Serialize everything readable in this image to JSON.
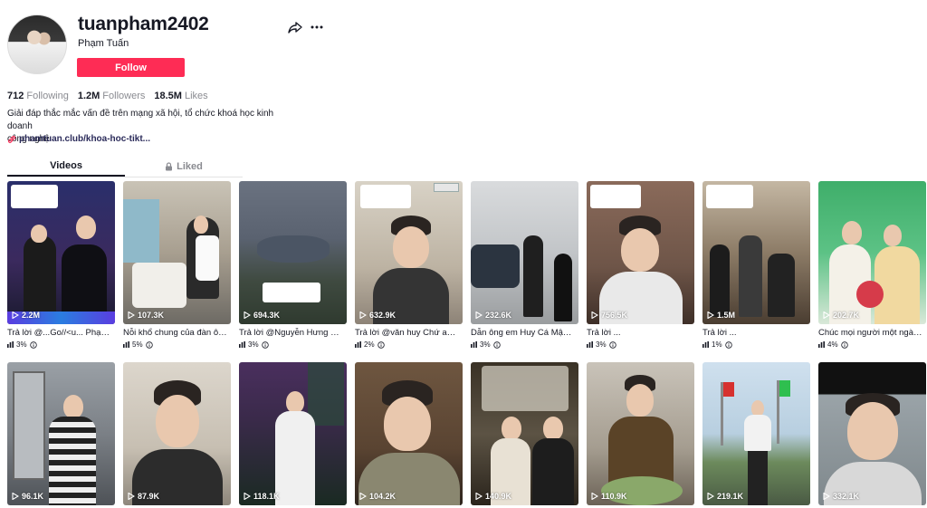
{
  "profile": {
    "username": "tuanpham2402",
    "nickname": "Phạm Tuấn",
    "follow_label": "Follow",
    "following_count": "712",
    "following_label": "Following",
    "followers_count": "1.2M",
    "followers_label": "Followers",
    "likes_count": "18.5M",
    "likes_label": "Likes",
    "bio_line1": "Giải đáp thắc mắc vấn đề trên mạng xã hội, tổ chức khoá học kinh doanh",
    "bio_line2": "công nghệ",
    "link": "phamtuan.club/khoa-hoc-tikt..."
  },
  "tabs": {
    "videos": "Videos",
    "liked": "Liked"
  },
  "colors": {
    "accent": "#fe2c55",
    "text": "#161823",
    "muted": "#8a8b91"
  },
  "row1": [
    {
      "views": "2.2M",
      "caption": "Trả lời @...Go//<u... Phạm ...",
      "pct": "3%"
    },
    {
      "views": "107.3K",
      "caption": "Nỗi khổ chung của đàn ôn...",
      "pct": "5%"
    },
    {
      "views": "694.3K",
      "caption": "Trả lời @Nguyễn Hưng Đic...",
      "pct": "3%"
    },
    {
      "views": "632.9K",
      "caption": "Trả lời @văn huy Chứ anh ...",
      "pct": "2%"
    },
    {
      "views": "232.6K",
      "caption": "Dẫn ông em Huy Cá Mập ...",
      "pct": "3%"
    },
    {
      "views": "756.5K",
      "caption": "Trả lời ...",
      "pct": "3%"
    },
    {
      "views": "1.5M",
      "caption": "Trả lời ...",
      "pct": "1%"
    },
    {
      "views": "202.7K",
      "caption": "Chúc mọi người một ngày ...",
      "pct": "4%"
    }
  ],
  "row2": [
    {
      "views": "96.1K"
    },
    {
      "views": "87.9K"
    },
    {
      "views": "118.1K"
    },
    {
      "views": "104.2K"
    },
    {
      "views": "140.9K"
    },
    {
      "views": "110.9K"
    },
    {
      "views": "219.1K"
    },
    {
      "views": "332.1K"
    }
  ]
}
